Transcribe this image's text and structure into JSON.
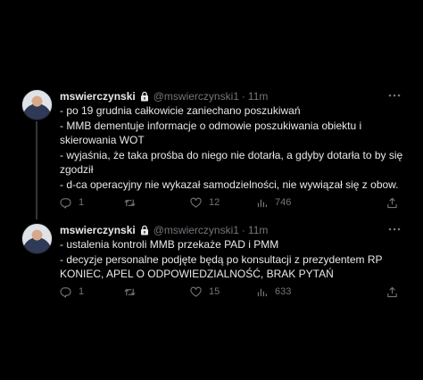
{
  "tweets": [
    {
      "display_name": "mswierczynski",
      "handle": "@mswierczynski1",
      "separator": "·",
      "time": "11m",
      "lines": [
        "- po 19 grudnia całkowicie zaniechano poszukiwań",
        "- MMB dementuje informacje o odmowie poszukiwania obiektu i",
        "skierowania WOT",
        "- wyjaśnia, że taka prośba do niego nie dotarła, a gdyby dotarła to by się",
        "zgodził",
        "- d-ca operacyjny nie wykazał samodzielności, nie wywiązał się z obow."
      ],
      "replies": "1",
      "retweets": "",
      "likes": "12",
      "views": "746"
    },
    {
      "display_name": "mswierczynski",
      "handle": "@mswierczynski1",
      "separator": "·",
      "time": "11m",
      "lines": [
        "- ustalenia kontroli MMB przekaże PAD i PMM",
        "- decyzje personalne podjęte będą po konsultacji z prezydentem RP",
        "KONIEC, APEL O ODPOWIEDZIALNOŚĆ, BRAK PYTAŃ"
      ],
      "replies": "1",
      "retweets": "",
      "likes": "15",
      "views": "633"
    }
  ],
  "colors": {
    "background": "#000000",
    "text": "#e7e9ea",
    "secondary": "#71767b",
    "thread_line": "#333639"
  },
  "icons": [
    "lock-icon",
    "more-icon",
    "reply-icon",
    "retweet-icon",
    "like-icon",
    "views-icon",
    "share-icon"
  ]
}
